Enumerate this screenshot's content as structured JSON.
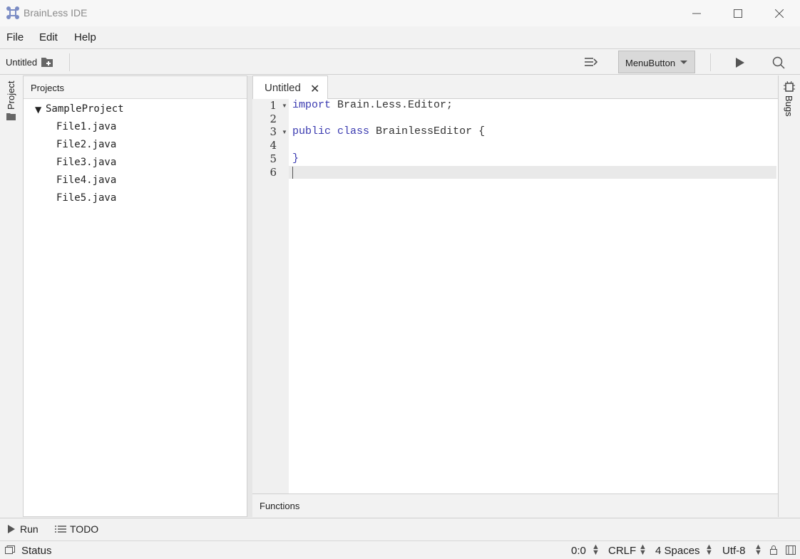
{
  "window": {
    "title": "BrainLess IDE",
    "controls": {
      "minimize": "minimize-icon",
      "maximize": "maximize-icon",
      "close": "close-icon"
    }
  },
  "menu": {
    "items": [
      "File",
      "Edit",
      "Help"
    ]
  },
  "toolbar": {
    "project_name": "Untitled",
    "menu_button_label": "MenuButton"
  },
  "left_strip": {
    "project_tab": "Project"
  },
  "projects_panel": {
    "header": "Projects",
    "root": "SampleProject",
    "files": [
      "File1.java",
      "File2.java",
      "File3.java",
      "File4.java",
      "File5.java"
    ]
  },
  "editor": {
    "tab_label": "Untitled",
    "line_numbers": [
      "1",
      "2",
      "3",
      "4",
      "5",
      "6"
    ],
    "code": {
      "line1_kw": "import",
      "line1_rest": " Brain.Less.Editor;",
      "line3_kw1": "public",
      "line3_kw2": "class",
      "line3_rest": " BrainlessEditor {",
      "line5": "}"
    },
    "bottom_panel": "Functions"
  },
  "right_strip": {
    "bugs_tab": "Bugs"
  },
  "run_bar": {
    "run_label": "Run",
    "todo_label": "TODO"
  },
  "status_bar": {
    "status": "Status",
    "position": "0:0",
    "line_ending": "CRLF",
    "indent": "4 Spaces",
    "encoding": "Utf-8"
  },
  "colors": {
    "keyword": "#3a3ab0",
    "menu_button_bg": "#d9d9d9",
    "accent_icon": "#6e7fb8"
  }
}
